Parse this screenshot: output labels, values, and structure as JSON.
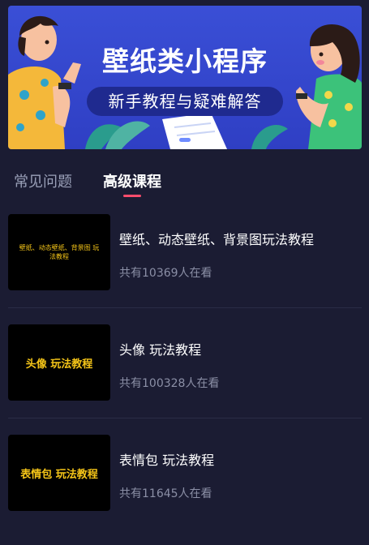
{
  "banner": {
    "title": "壁纸类小程序",
    "subtitle": "新手教程与疑难解答"
  },
  "tabs": [
    {
      "label": "常见问题",
      "active": false
    },
    {
      "label": "高级课程",
      "active": true
    }
  ],
  "courses": [
    {
      "thumb_text": "壁纸、动态壁纸、背景图 玩法教程",
      "title": "壁纸、动态壁纸、背景图玩法教程",
      "viewers": "共有10369人在看"
    },
    {
      "thumb_text": "头像 玩法教程",
      "title": "头像 玩法教程",
      "viewers": "共有100328人在看"
    },
    {
      "thumb_text": "表情包 玩法教程",
      "title": "表情包 玩法教程",
      "viewers": "共有11645人在看"
    }
  ],
  "colors": {
    "background": "#1b1c33",
    "banner": "#3a4fd6",
    "accent": "#ff4d6d",
    "thumb_text": "#f5c518"
  }
}
